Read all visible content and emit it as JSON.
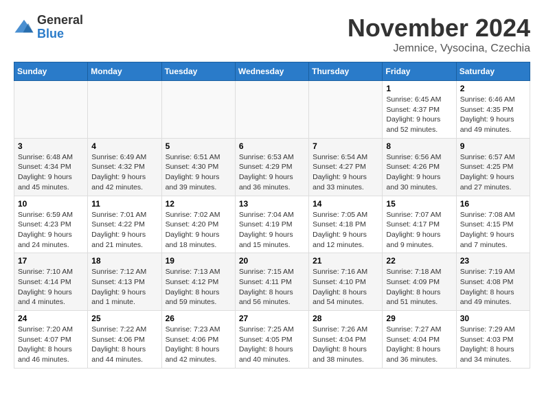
{
  "logo": {
    "general": "General",
    "blue": "Blue"
  },
  "title": "November 2024",
  "subtitle": "Jemnice, Vysocina, Czechia",
  "days_header": [
    "Sunday",
    "Monday",
    "Tuesday",
    "Wednesday",
    "Thursday",
    "Friday",
    "Saturday"
  ],
  "weeks": [
    [
      {
        "day": "",
        "info": ""
      },
      {
        "day": "",
        "info": ""
      },
      {
        "day": "",
        "info": ""
      },
      {
        "day": "",
        "info": ""
      },
      {
        "day": "",
        "info": ""
      },
      {
        "day": "1",
        "info": "Sunrise: 6:45 AM\nSunset: 4:37 PM\nDaylight: 9 hours\nand 52 minutes."
      },
      {
        "day": "2",
        "info": "Sunrise: 6:46 AM\nSunset: 4:35 PM\nDaylight: 9 hours\nand 49 minutes."
      }
    ],
    [
      {
        "day": "3",
        "info": "Sunrise: 6:48 AM\nSunset: 4:34 PM\nDaylight: 9 hours\nand 45 minutes."
      },
      {
        "day": "4",
        "info": "Sunrise: 6:49 AM\nSunset: 4:32 PM\nDaylight: 9 hours\nand 42 minutes."
      },
      {
        "day": "5",
        "info": "Sunrise: 6:51 AM\nSunset: 4:30 PM\nDaylight: 9 hours\nand 39 minutes."
      },
      {
        "day": "6",
        "info": "Sunrise: 6:53 AM\nSunset: 4:29 PM\nDaylight: 9 hours\nand 36 minutes."
      },
      {
        "day": "7",
        "info": "Sunrise: 6:54 AM\nSunset: 4:27 PM\nDaylight: 9 hours\nand 33 minutes."
      },
      {
        "day": "8",
        "info": "Sunrise: 6:56 AM\nSunset: 4:26 PM\nDaylight: 9 hours\nand 30 minutes."
      },
      {
        "day": "9",
        "info": "Sunrise: 6:57 AM\nSunset: 4:25 PM\nDaylight: 9 hours\nand 27 minutes."
      }
    ],
    [
      {
        "day": "10",
        "info": "Sunrise: 6:59 AM\nSunset: 4:23 PM\nDaylight: 9 hours\nand 24 minutes."
      },
      {
        "day": "11",
        "info": "Sunrise: 7:01 AM\nSunset: 4:22 PM\nDaylight: 9 hours\nand 21 minutes."
      },
      {
        "day": "12",
        "info": "Sunrise: 7:02 AM\nSunset: 4:20 PM\nDaylight: 9 hours\nand 18 minutes."
      },
      {
        "day": "13",
        "info": "Sunrise: 7:04 AM\nSunset: 4:19 PM\nDaylight: 9 hours\nand 15 minutes."
      },
      {
        "day": "14",
        "info": "Sunrise: 7:05 AM\nSunset: 4:18 PM\nDaylight: 9 hours\nand 12 minutes."
      },
      {
        "day": "15",
        "info": "Sunrise: 7:07 AM\nSunset: 4:17 PM\nDaylight: 9 hours\nand 9 minutes."
      },
      {
        "day": "16",
        "info": "Sunrise: 7:08 AM\nSunset: 4:15 PM\nDaylight: 9 hours\nand 7 minutes."
      }
    ],
    [
      {
        "day": "17",
        "info": "Sunrise: 7:10 AM\nSunset: 4:14 PM\nDaylight: 9 hours\nand 4 minutes."
      },
      {
        "day": "18",
        "info": "Sunrise: 7:12 AM\nSunset: 4:13 PM\nDaylight: 9 hours\nand 1 minute."
      },
      {
        "day": "19",
        "info": "Sunrise: 7:13 AM\nSunset: 4:12 PM\nDaylight: 8 hours\nand 59 minutes."
      },
      {
        "day": "20",
        "info": "Sunrise: 7:15 AM\nSunset: 4:11 PM\nDaylight: 8 hours\nand 56 minutes."
      },
      {
        "day": "21",
        "info": "Sunrise: 7:16 AM\nSunset: 4:10 PM\nDaylight: 8 hours\nand 54 minutes."
      },
      {
        "day": "22",
        "info": "Sunrise: 7:18 AM\nSunset: 4:09 PM\nDaylight: 8 hours\nand 51 minutes."
      },
      {
        "day": "23",
        "info": "Sunrise: 7:19 AM\nSunset: 4:08 PM\nDaylight: 8 hours\nand 49 minutes."
      }
    ],
    [
      {
        "day": "24",
        "info": "Sunrise: 7:20 AM\nSunset: 4:07 PM\nDaylight: 8 hours\nand 46 minutes."
      },
      {
        "day": "25",
        "info": "Sunrise: 7:22 AM\nSunset: 4:06 PM\nDaylight: 8 hours\nand 44 minutes."
      },
      {
        "day": "26",
        "info": "Sunrise: 7:23 AM\nSunset: 4:06 PM\nDaylight: 8 hours\nand 42 minutes."
      },
      {
        "day": "27",
        "info": "Sunrise: 7:25 AM\nSunset: 4:05 PM\nDaylight: 8 hours\nand 40 minutes."
      },
      {
        "day": "28",
        "info": "Sunrise: 7:26 AM\nSunset: 4:04 PM\nDaylight: 8 hours\nand 38 minutes."
      },
      {
        "day": "29",
        "info": "Sunrise: 7:27 AM\nSunset: 4:04 PM\nDaylight: 8 hours\nand 36 minutes."
      },
      {
        "day": "30",
        "info": "Sunrise: 7:29 AM\nSunset: 4:03 PM\nDaylight: 8 hours\nand 34 minutes."
      }
    ]
  ]
}
